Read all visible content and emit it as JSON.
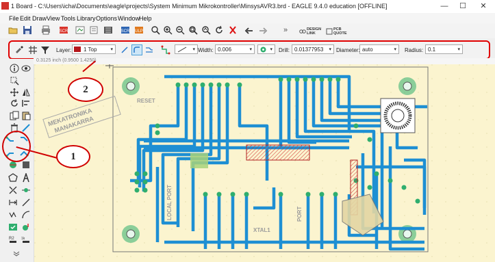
{
  "window": {
    "title": "1 Board - C:\\Users\\icha\\Documents\\eagle\\projects\\System Minimum Mikrokontroller\\MinsysAVR3.brd - EAGLE 9.4.0 education [OFFLINE]",
    "minimize": "—",
    "maximize": "☐",
    "close": "✕"
  },
  "menu": [
    "File",
    "Edit",
    "Draw",
    "View",
    "Tools",
    "Library",
    "Options",
    "Window",
    "Help"
  ],
  "toolbar": {
    "design_link": "DESIGN LINK",
    "pcb_quote": "PCB QUOTE",
    "more": "»"
  },
  "params": {
    "layer_label": "Layer:",
    "layer_value": "1 Top",
    "layer_color": "#b5161b",
    "width_label": "Width:",
    "width_value": "0.006",
    "drill_label": "Drill:",
    "drill_value": "0.01377953",
    "diameter_label": "Diameter:",
    "diameter_value": "auto",
    "radius_label": "Radius:",
    "radius_value": "0.1"
  },
  "coordinates": "0.3125 inch (0.9500 1.4250)",
  "board": {
    "silk_texts": [
      "RESET",
      "LOCAL PORT",
      "XTAL1",
      "PORT"
    ],
    "logo": "MEKATRONIKA\nMANAKARRA"
  },
  "callouts": {
    "one": "1",
    "two": "2"
  },
  "colors": {
    "canvas": "#fbf4cf",
    "trace": "#1e8fd3",
    "pad": "#2fae6e",
    "callout": "#d00000"
  }
}
